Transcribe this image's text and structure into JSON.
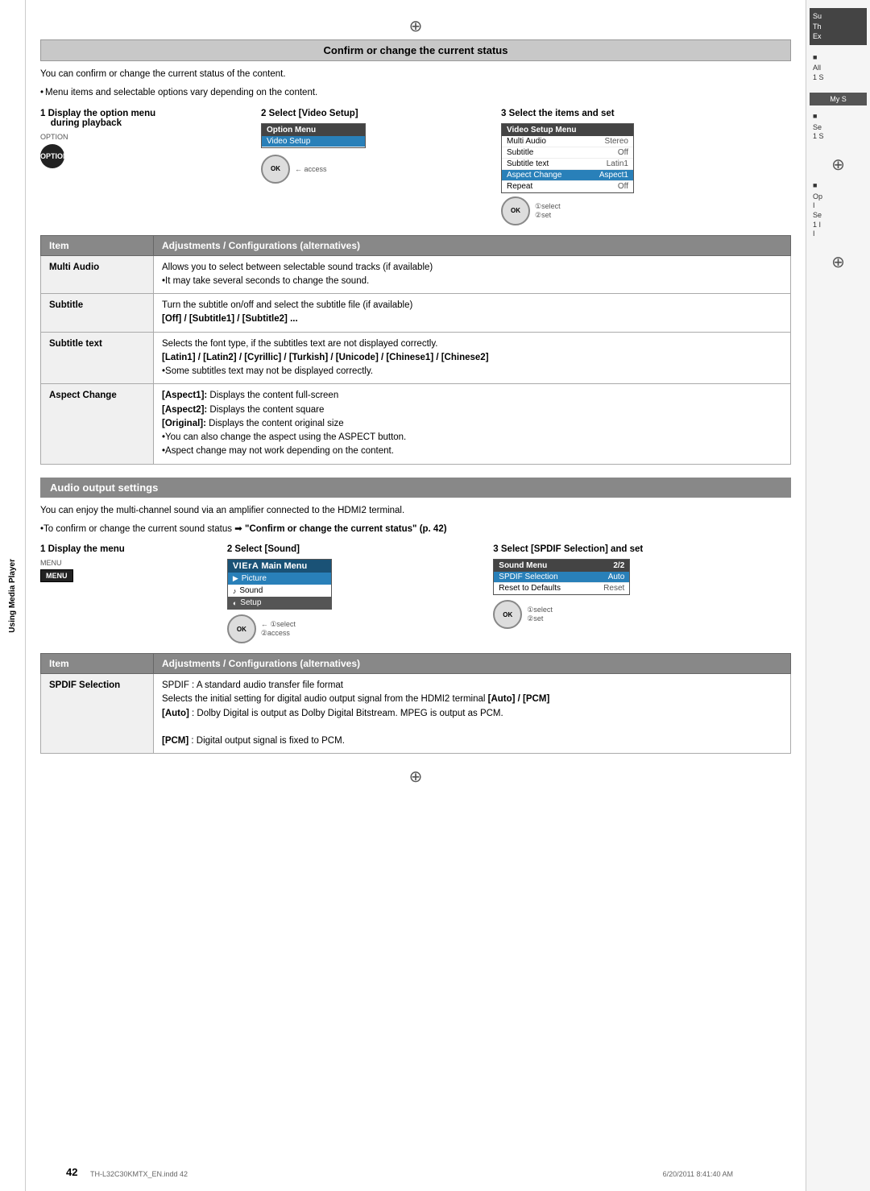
{
  "page": {
    "number": "42",
    "footer_file": "TH-L32C30KMTX_EN.indd   42",
    "footer_date": "6/20/2011  8:41:40 AM",
    "compass_symbol": "⊕"
  },
  "sidebar": {
    "vertical_label": "Using Media Player"
  },
  "section1": {
    "title": "Confirm or change the current status",
    "intro1": "You can confirm or change the current status of the content.",
    "intro2": "Menu items and selectable options vary depending on the content.",
    "step1_title": "1  Display the option menu\n    during playback",
    "step2_title": "2  Select [Video Setup]",
    "step3_title": "3  Select the items and set",
    "option_label": "OPTION",
    "option_menu_title": "Option Menu",
    "option_menu_item": "Video Setup",
    "video_setup_menu_title": "Video Setup Menu",
    "video_menu_items": [
      {
        "label": "Multi Audio",
        "value": "Stereo",
        "highlighted": false
      },
      {
        "label": "Subtitle",
        "value": "Off",
        "highlighted": false
      },
      {
        "label": "Subtitle text",
        "value": "Latin1",
        "highlighted": false
      },
      {
        "label": "Aspect Change",
        "value": "Aspect1",
        "highlighted": true
      },
      {
        "label": "Repeat",
        "value": "Off",
        "highlighted": false
      }
    ],
    "select_label": "①select",
    "set_label": "②set",
    "access_label": "access",
    "table_col1": "Item",
    "table_col2": "Adjustments / Configurations (alternatives)",
    "rows": [
      {
        "item": "Multi Audio",
        "description": "Allows you to select between selectable sound tracks (if available)\n•It may take several seconds to change the sound."
      },
      {
        "item": "Subtitle",
        "description": "Turn the subtitle on/off and select the subtitle file (if available)\n[Off] / [Subtitle1] / [Subtitle2] ..."
      },
      {
        "item": "Subtitle text",
        "description": "[Latin1] / [Latin2] / [Cyrillic] / [Turkish] / [Unicode] / [Chinese1] / [Chinese2]\n•Some subtitles text may not be displayed correctly.",
        "prefix": "Selects the font type, if the subtitles text are not displayed correctly."
      },
      {
        "item": "Aspect Change",
        "description": "[Aspect1]: Displays the content full-screen\n[Aspect2]: Displays the content square\n[Original]: Displays the content original size\n•You can also change the aspect using the ASPECT button.\n•Aspect change may not work depending on the content."
      }
    ]
  },
  "section2": {
    "title": "Audio output settings",
    "intro1": "You can enjoy the multi-channel sound via an amplifier connected to the HDMI2 terminal.",
    "intro2": "To confirm or change the current sound status ➡ \"Confirm or change the current status\" (p. 42)",
    "step1_title": "1  Display the menu",
    "step2_title": "2  Select [Sound]",
    "step3_title": "3  Select [SPDIF Selection] and set",
    "menu_label": "MENU",
    "viera_title": "VIErA Main Menu",
    "viera_menu": [
      {
        "label": "Picture",
        "icon": "▶",
        "highlighted": true
      },
      {
        "label": "Sound",
        "icon": "♪",
        "highlighted": false
      },
      {
        "label": "Setup",
        "icon": "◐",
        "highlighted": false,
        "selected": true
      }
    ],
    "select_label": "①select",
    "access_label": "②access",
    "sound_menu_title": "Sound Menu",
    "sound_menu_page": "2/2",
    "sound_menu_items": [
      {
        "label": "SPDIF Selection",
        "value": "Auto",
        "highlighted": true
      },
      {
        "label": "Reset to Defaults",
        "value": "Reset",
        "highlighted": false
      }
    ],
    "select_label2": "①select",
    "set_label2": "②set",
    "table_col1": "Item",
    "table_col2": "Adjustments / Configurations (alternatives)",
    "rows": [
      {
        "item": "SPDIF Selection",
        "lines": [
          "SPDIF : A standard audio transfer file format",
          "Selects the initial setting for digital audio output signal from the HDMI2 terminal [Auto] / [PCM]",
          "[Auto] : Dolby Digital is output as Dolby Digital Bitstream. MPEG is output as PCM.",
          "[PCM] : Digital output signal is fixed to PCM."
        ]
      }
    ]
  },
  "right_sidebar": {
    "blocks": [
      {
        "text": "Su\nTh\nEx",
        "dark": false
      },
      {
        "text": "All\n1 S",
        "dark": false
      },
      {
        "text": "Se\n1 S",
        "dark": false
      },
      {
        "text": "Op\nI\nSe\n1 I\nI",
        "dark": false
      }
    ],
    "tabs": [
      "My S"
    ]
  }
}
